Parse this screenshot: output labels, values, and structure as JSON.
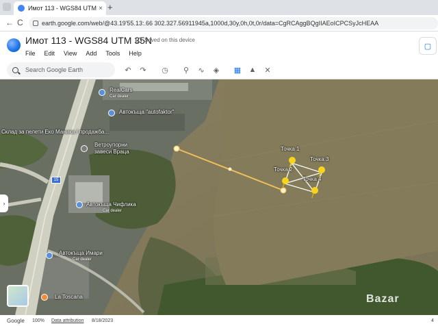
{
  "browser": {
    "tab_title": "Имот 113 - WGS84 UTM 35N",
    "tab_close": "×",
    "new_tab": "+",
    "back": "←",
    "forward": "→",
    "reload": "C",
    "url": "earth.google.com/web/@43.19'55.13:.66 302.327.56911945a,1000d,30y,0h,0t,0r/data=CgRCAggBQgIIAEoICPCSyJcHEAA"
  },
  "app": {
    "doc_title": "Имот 113 - WGS84 UTM 35N",
    "saved_status": "Saved on this device",
    "menus": [
      "File",
      "Edit",
      "View",
      "Add",
      "Tools",
      "Help"
    ],
    "side_button": "▢"
  },
  "toolbar": {
    "search_placeholder": "Search Google Earth",
    "icons": [
      "undo-icon",
      "redo-icon",
      "history-icon",
      "placemark-icon",
      "path-icon",
      "layers-icon",
      "ruler-icon",
      "image-icon",
      "tools-icon"
    ]
  },
  "map": {
    "places": [
      {
        "name": "RealCars",
        "sub": "Car dealer"
      },
      {
        "name": "Автокъща \"autofaktor\"",
        "sub": ""
      },
      {
        "name": "Склад за пелети Еко Маника / продажба...",
        "sub": ""
      },
      {
        "name": "Ветроупорни завеси Враца",
        "sub": ""
      },
      {
        "name": "Автокъща Чифлика",
        "sub": "Car dealer"
      },
      {
        "name": "Автокъща Имари",
        "sub": "Car dealer"
      },
      {
        "name": "La Toscana",
        "sub": ""
      }
    ],
    "points": [
      "Точка 1",
      "Точка 2",
      "Точка 3",
      "Точка 4"
    ],
    "route_label": "15",
    "watermark": "Bazar"
  },
  "status": {
    "brand": "Google",
    "zoom": "100%",
    "attribution": "Data attribution",
    "date": "8/18/2023",
    "altitude": "4"
  },
  "colors": {
    "field": "#7f7a58",
    "urban": "#6d7268",
    "road": "#cfd0c2",
    "measure_line": "#f0c05a",
    "pin": "#f7d51d"
  }
}
